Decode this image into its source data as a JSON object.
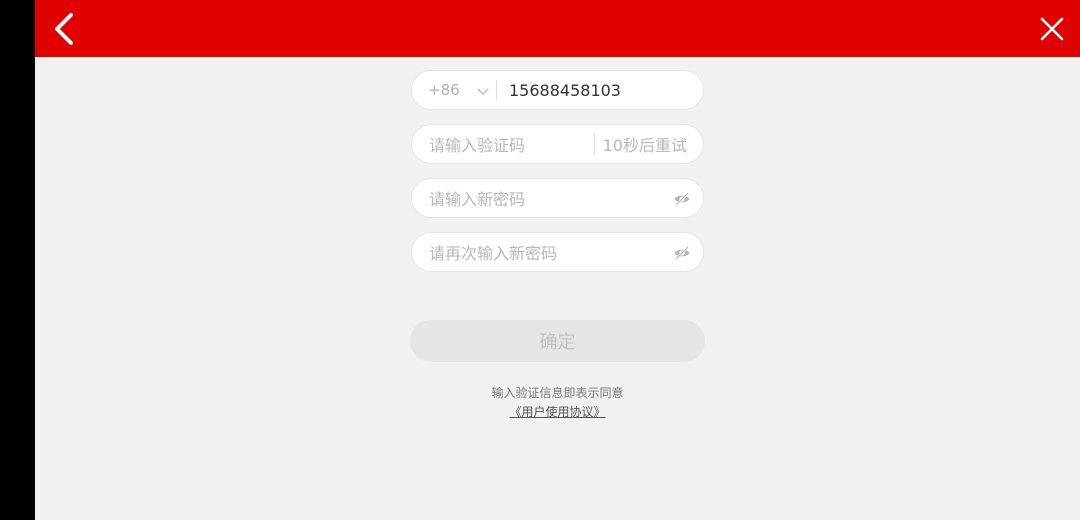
{
  "colors": {
    "header": "#e10000",
    "side_bar": "#000000",
    "background": "#f1f1f1",
    "button_disabled": "#e5e5e5"
  },
  "header": {
    "back_icon": "chevron-left-icon",
    "close_icon": "close-icon"
  },
  "phone": {
    "country_code": "+86",
    "value": "15688458103"
  },
  "code": {
    "placeholder": "请输入验证码",
    "resend_label": "10秒后重试"
  },
  "password": {
    "placeholder": "请输入新密码",
    "toggle_icon": "eye-off-icon"
  },
  "password_confirm": {
    "placeholder": "请再次输入新密码",
    "toggle_icon": "eye-off-icon"
  },
  "confirm_button": {
    "label": "确定"
  },
  "agreement": {
    "text": "输入验证信息即表示同意",
    "link": "《用户使用协议》"
  }
}
